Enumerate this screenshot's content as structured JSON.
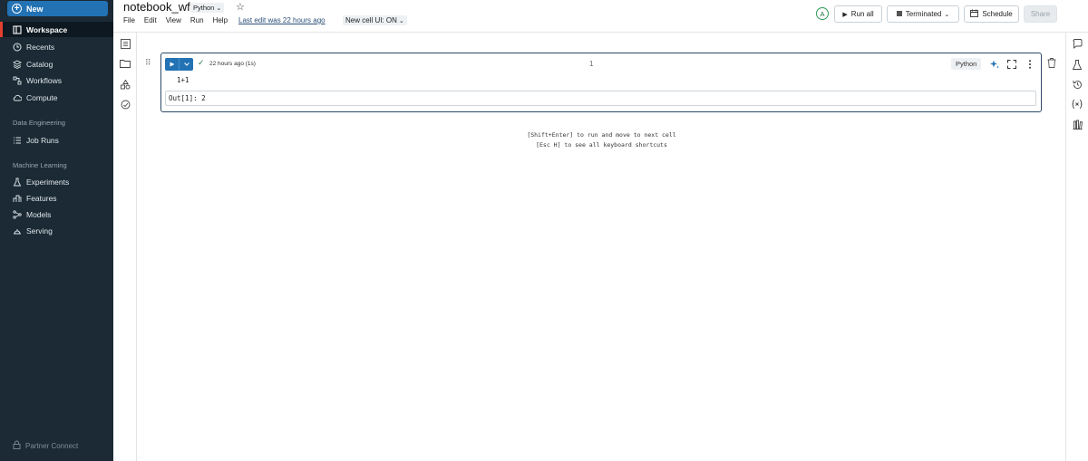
{
  "nav": {
    "new_label": "New",
    "items": [
      {
        "label": "Workspace",
        "icon": "workspace-icon"
      },
      {
        "label": "Recents",
        "icon": "clock-icon"
      },
      {
        "label": "Catalog",
        "icon": "catalog-icon"
      },
      {
        "label": "Workflows",
        "icon": "workflow-icon"
      },
      {
        "label": "Compute",
        "icon": "cloud-icon"
      }
    ],
    "section_data_engineering": "Data Engineering",
    "job_runs": "Job Runs",
    "section_ml": "Machine Learning",
    "ml_items": [
      {
        "label": "Experiments",
        "icon": "flask-icon"
      },
      {
        "label": "Features",
        "icon": "features-icon"
      },
      {
        "label": "Models",
        "icon": "models-icon"
      },
      {
        "label": "Serving",
        "icon": "serving-icon"
      }
    ],
    "partner_connect": "Partner Connect",
    "active_accent": "#e3402f",
    "background": "#1b2a34"
  },
  "header": {
    "title": "notebook_wf",
    "language": "Python",
    "menu": [
      "File",
      "Edit",
      "View",
      "Run",
      "Help"
    ],
    "last_edit": "Last edit was 22 hours ago",
    "new_cell_ui": "New cell UI: ON",
    "avatar": "A",
    "run_all": "Run all",
    "cluster_status": "Terminated",
    "schedule": "Schedule",
    "share": "Share"
  },
  "cell": {
    "run_time": "22 hours ago (1s)",
    "number": "1",
    "language": "Python",
    "code": "1+1",
    "output": "Out[1]: 2"
  },
  "hints": {
    "line1": "[Shift+Enter] to run and move to next cell",
    "line2": "[Esc H] to see all keyboard shortcuts"
  },
  "colors": {
    "primary": "#2272b4",
    "cell_border": "#2d4a66"
  }
}
